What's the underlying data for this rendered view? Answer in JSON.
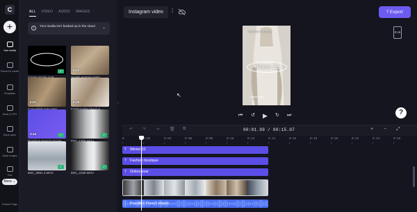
{
  "rail": {
    "items": [
      {
        "label": "Your media",
        "icon": "folder-icon",
        "active": true
      },
      {
        "label": "Record & create",
        "icon": "camera-icon",
        "active": false
      },
      {
        "label": "Templates",
        "icon": "templates-icon",
        "active": false
      },
      {
        "label": "Music & SFX",
        "icon": "music-icon",
        "active": false
      },
      {
        "label": "Stock video",
        "icon": "film-icon",
        "active": false
      },
      {
        "label": "Stock images",
        "icon": "image-icon",
        "active": false
      },
      {
        "label": "Text",
        "icon": "text-icon",
        "active": false
      }
    ],
    "more_label": "More",
    "bottom_label": "Feature Flags"
  },
  "media": {
    "tabs": [
      "ALL",
      "VIDEO",
      "AUDIO",
      "IMAGES"
    ],
    "backup_notice": "Your media isn't backed up in the cloud",
    "items": [
      {
        "caption": "Cream stroke oval",
        "duration": "",
        "checked": true
      },
      {
        "caption": "Stylish woman posin...",
        "duration": "0:07",
        "checked": false
      },
      {
        "caption": "Coquettish lady resti...",
        "duration": "0:07",
        "checked": false
      },
      {
        "caption": "Fashionable blond w...",
        "duration": "0:20",
        "checked": false
      },
      {
        "caption": "Possitive French House",
        "duration": "3:44",
        "checked": true
      },
      {
        "caption": "IMG_1406.MOV",
        "duration": "",
        "checked": true
      },
      {
        "caption": "IMG_3991 2.MOV",
        "duration": "",
        "checked": true
      },
      {
        "caption": "IMG_4159.MOV",
        "duration": "",
        "checked": true
      }
    ]
  },
  "project": {
    "title": "Instagram video",
    "menu": "⋮"
  },
  "export": {
    "label": "Export"
  },
  "preview": {
    "top_text": "Fashion boutique",
    "main_text": "Winter 22",
    "bottom_text": "Online now",
    "ratio": "9:16"
  },
  "playback": {
    "current": "00:01.99",
    "total": "00:15.07"
  },
  "help": "?",
  "timeline": {
    "ticks": [
      "0",
      "0:02",
      "0:04",
      "0:06",
      "0:08",
      "0:10",
      "0:12",
      "0:14",
      "0:16",
      "0:18",
      "0:20",
      "0:22",
      "0:24",
      "0:26"
    ],
    "text_tracks": [
      "Winter 22",
      "Fashion boutique",
      "Online now"
    ],
    "audio_track": "Possitive French House"
  },
  "colors": {
    "accent": "#6b5bf0",
    "text_track": "#5b4ee6",
    "audio_track": "#4a6ff0",
    "check": "#2db47a"
  }
}
